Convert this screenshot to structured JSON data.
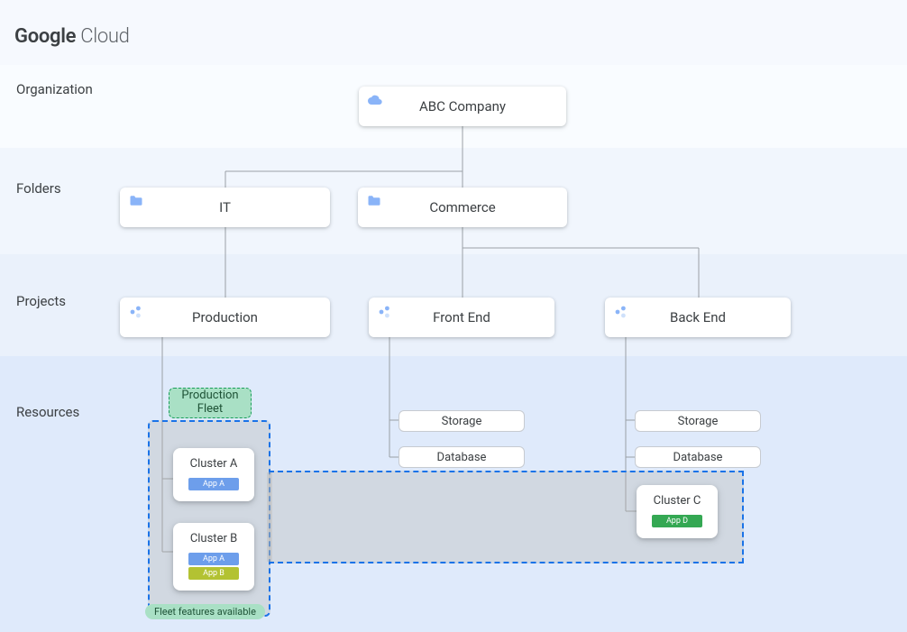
{
  "logo": {
    "bold": "Google",
    "thin": " Cloud"
  },
  "rows": {
    "organization": "Organization",
    "folders": "Folders",
    "projects": "Projects",
    "resources": "Resources"
  },
  "org_node": "ABC Company",
  "folders_nodes": {
    "it": "IT",
    "commerce": "Commerce"
  },
  "projects_nodes": {
    "production": "Production",
    "frontend": "Front End",
    "backend": "Back End"
  },
  "resources": {
    "frontend": {
      "storage": "Storage",
      "database": "Database"
    },
    "backend": {
      "storage": "Storage",
      "database": "Database"
    }
  },
  "fleet": {
    "badge": "Production Fleet",
    "footer": "Fleet features available"
  },
  "clusters": {
    "a": {
      "title": "Cluster A",
      "apps": [
        "App A"
      ]
    },
    "b": {
      "title": "Cluster B",
      "apps": [
        "App A",
        "App B"
      ]
    },
    "c": {
      "title": "Cluster C",
      "apps": [
        "App D"
      ]
    }
  },
  "colors": {
    "app_a": "#6d9eeb",
    "app_b": "#b3c232",
    "app_d": "#34a853",
    "fleet_border": "#1a73e8",
    "badge_bg": "#a9e0c5"
  }
}
